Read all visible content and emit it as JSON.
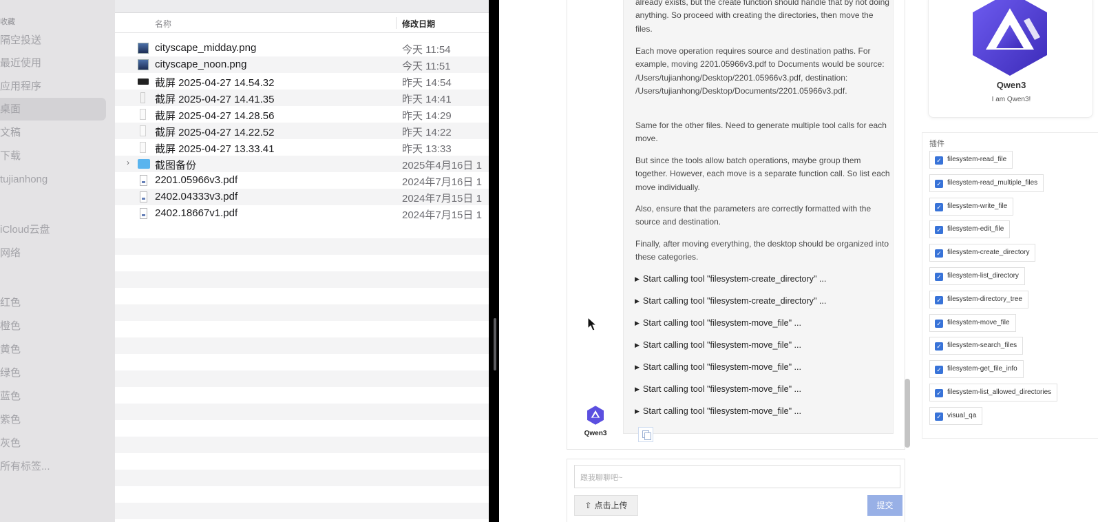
{
  "finder": {
    "sidebar": {
      "favorites_header": "收藏",
      "items": [
        {
          "label": "隔空投送"
        },
        {
          "label": "最近使用"
        },
        {
          "label": "应用程序"
        },
        {
          "label": "桌面",
          "active": true
        },
        {
          "label": "文稿"
        },
        {
          "label": "下载"
        },
        {
          "label": "tujianhong"
        },
        {
          "label": "iCloud云盘"
        },
        {
          "label": "网络"
        },
        {
          "label": "红色"
        },
        {
          "label": "橙色"
        },
        {
          "label": "黄色"
        },
        {
          "label": "绿色"
        },
        {
          "label": "蓝色"
        },
        {
          "label": "紫色"
        },
        {
          "label": "灰色"
        },
        {
          "label": "所有标签..."
        }
      ]
    },
    "columns": {
      "name": "名称",
      "date": "修改日期"
    },
    "files": [
      {
        "name": "cityscape_midday.png",
        "date": "今天 11:54",
        "icon": "image-file-icon"
      },
      {
        "name": "cityscape_noon.png",
        "date": "今天 11:51",
        "icon": "image-file-icon"
      },
      {
        "name": "截屏 2025-04-27 14.54.32",
        "date": "昨天 14:54",
        "icon": "screenshot-file-icon"
      },
      {
        "name": "截屏 2025-04-27 14.41.35",
        "date": "昨天 14:41",
        "icon": "screenshot-file-icon"
      },
      {
        "name": "截屏 2025-04-27 14.28.56",
        "date": "昨天 14:29",
        "icon": "screenshot-file-icon"
      },
      {
        "name": "截屏 2025-04-27 14.22.52",
        "date": "昨天 14:22",
        "icon": "screenshot-file-icon"
      },
      {
        "name": "截屏 2025-04-27 13.33.41",
        "date": "昨天 13:33",
        "icon": "screenshot-file-icon"
      },
      {
        "name": "截图备份",
        "date": "2025年4月16日 1",
        "icon": "folder-icon"
      },
      {
        "name": "2201.05966v3.pdf",
        "date": "2024年7月16日 1",
        "icon": "pdf-file-icon"
      },
      {
        "name": "2402.04333v3.pdf",
        "date": "2024年7月15日 1",
        "icon": "pdf-file-icon"
      },
      {
        "name": "2402.18667v1.pdf",
        "date": "2024年7月15日 1",
        "icon": "pdf-file-icon"
      }
    ]
  },
  "chat": {
    "paragraphs": [
      "already exists, but the create function should handle that by not doing anything. So proceed with creating the directories, then move the files.",
      "Each move operation requires source and destination paths. For example, moving 2201.05966v3.pdf to Documents would be source: /Users/tujianhong/Desktop/2201.05966v3.pdf, destination: /Users/tujianhong/Desktop/Documents/2201.05966v3.pdf.",
      "Same for the other files. Need to generate multiple tool calls for each move.",
      "But since the tools allow batch operations, maybe group them together. However, each move is a separate function call. So list each move individually.",
      "Also, ensure that the parameters are correctly formatted with the source and destination.",
      "Finally, after moving everything, the desktop should be organized into these categories."
    ],
    "tool_calls": [
      "Start calling tool \"filesystem-create_directory\" ...",
      "Start calling tool \"filesystem-create_directory\" ...",
      "Start calling tool \"filesystem-move_file\" ...",
      "Start calling tool \"filesystem-move_file\" ...",
      "Start calling tool \"filesystem-move_file\" ...",
      "Start calling tool \"filesystem-move_file\" ...",
      "Start calling tool \"filesystem-move_file\" ..."
    ],
    "avatar_name": "Qwen3",
    "input_placeholder": "跟我聊聊吧~",
    "upload_label": "点击上传",
    "submit_label": "提交"
  },
  "agent": {
    "name": "Qwen3",
    "intro": "I am Qwen3!",
    "brand_color": "#5b4fe0"
  },
  "plugins": {
    "title": "插件",
    "items": [
      {
        "label": "filesystem-read_file",
        "checked": true
      },
      {
        "label": "filesystem-read_multiple_files",
        "checked": true
      },
      {
        "label": "filesystem-write_file",
        "checked": true
      },
      {
        "label": "filesystem-edit_file",
        "checked": true
      },
      {
        "label": "filesystem-create_directory",
        "checked": true
      },
      {
        "label": "filesystem-list_directory",
        "checked": true
      },
      {
        "label": "filesystem-directory_tree",
        "checked": true
      },
      {
        "label": "filesystem-move_file",
        "checked": true
      },
      {
        "label": "filesystem-search_files",
        "checked": true
      },
      {
        "label": "filesystem-get_file_info",
        "checked": true
      },
      {
        "label": "filesystem-list_allowed_directories",
        "checked": true
      },
      {
        "label": "visual_qa",
        "checked": true
      }
    ]
  }
}
